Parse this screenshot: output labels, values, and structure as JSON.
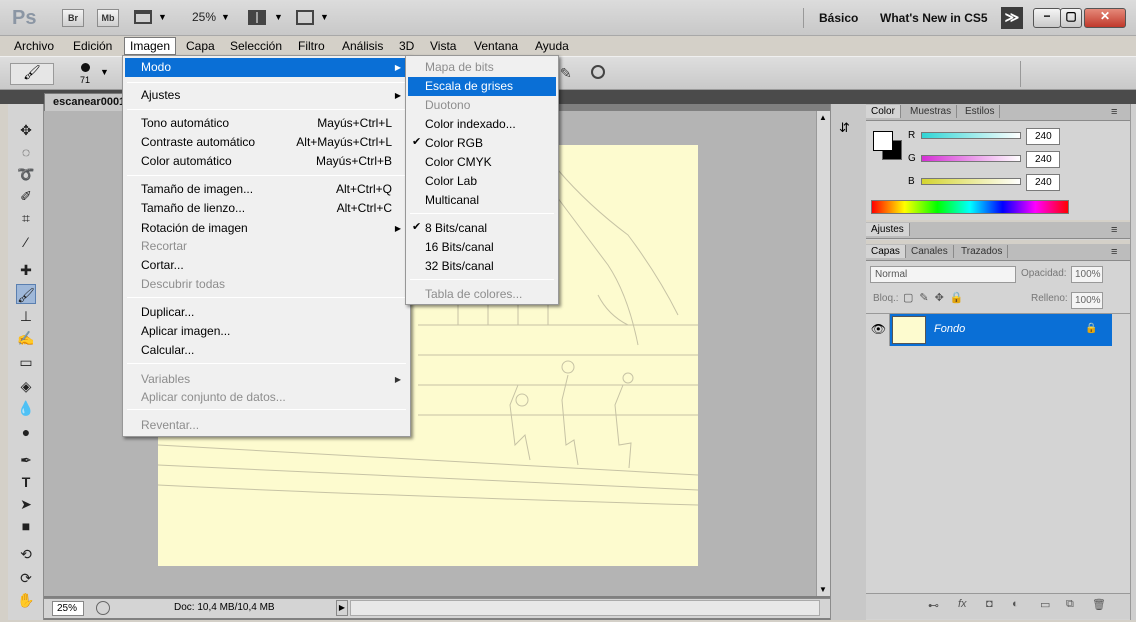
{
  "app": {
    "logo": "Ps",
    "title_buttons": [
      "Br",
      "Mb"
    ],
    "zoom": "25%",
    "workspace_presets": [
      "Básico",
      "What's New in CS5"
    ],
    "more_label": "≫"
  },
  "menubar": [
    "Archivo",
    "Edición",
    "Imagen",
    "Capa",
    "Selección",
    "Filtro",
    "Análisis",
    "3D",
    "Vista",
    "Ventana",
    "Ayuda"
  ],
  "options": {
    "brush_size": "71"
  },
  "document": {
    "tab": "escanear0001"
  },
  "imagen_menu": {
    "items": [
      {
        "label": "Modo",
        "shortcut": "",
        "submenu": true,
        "disabled": false,
        "highlight": true
      },
      {
        "label": "Ajustes",
        "shortcut": "",
        "submenu": true,
        "disabled": false
      },
      {
        "label": "Tono automático",
        "shortcut": "Mayús+Ctrl+L",
        "disabled": false
      },
      {
        "label": "Contraste automático",
        "shortcut": "Alt+Mayús+Ctrl+L",
        "disabled": false
      },
      {
        "label": "Color automático",
        "shortcut": "Mayús+Ctrl+B",
        "disabled": false
      },
      {
        "label": "Tamaño de imagen...",
        "shortcut": "Alt+Ctrl+Q",
        "disabled": false
      },
      {
        "label": "Tamaño de lienzo...",
        "shortcut": "Alt+Ctrl+C",
        "disabled": false
      },
      {
        "label": "Rotación de imagen",
        "shortcut": "",
        "submenu": true,
        "disabled": false
      },
      {
        "label": "Recortar",
        "shortcut": "",
        "disabled": true
      },
      {
        "label": "Cortar...",
        "shortcut": "",
        "disabled": false
      },
      {
        "label": "Descubrir todas",
        "shortcut": "",
        "disabled": true
      },
      {
        "label": "Duplicar...",
        "shortcut": "",
        "disabled": false
      },
      {
        "label": "Aplicar imagen...",
        "shortcut": "",
        "disabled": false
      },
      {
        "label": "Calcular...",
        "shortcut": "",
        "disabled": false
      },
      {
        "label": "Variables",
        "shortcut": "",
        "submenu": true,
        "disabled": true
      },
      {
        "label": "Aplicar conjunto de datos...",
        "shortcut": "",
        "disabled": true
      },
      {
        "label": "Reventar...",
        "shortcut": "",
        "disabled": true
      }
    ]
  },
  "modo_menu": {
    "items": [
      {
        "label": "Mapa de bits",
        "disabled": true
      },
      {
        "label": "Escala de grises",
        "disabled": false,
        "highlight": true
      },
      {
        "label": "Duotono",
        "disabled": true
      },
      {
        "label": "Color indexado...",
        "disabled": false
      },
      {
        "label": "Color RGB",
        "disabled": false,
        "checked": true
      },
      {
        "label": "Color CMYK",
        "disabled": false
      },
      {
        "label": "Color Lab",
        "disabled": false
      },
      {
        "label": "Multicanal",
        "disabled": false
      },
      {
        "label": "8 Bits/canal",
        "disabled": false,
        "checked": true
      },
      {
        "label": "16 Bits/canal",
        "disabled": false
      },
      {
        "label": "32 Bits/canal",
        "disabled": false
      },
      {
        "label": "Tabla de colores...",
        "disabled": true
      }
    ]
  },
  "color_panel": {
    "tabs": [
      "Color",
      "Muestras",
      "Estilos"
    ],
    "channels": [
      {
        "name": "R",
        "value": "240",
        "color": "#2fd4d4"
      },
      {
        "name": "G",
        "value": "240",
        "color": "#d42fd4"
      },
      {
        "name": "B",
        "value": "240",
        "color": "#d4d42f"
      }
    ]
  },
  "adjust_panel": {
    "title": "Ajustes"
  },
  "layers_panel": {
    "tabs": [
      "Capas",
      "Canales",
      "Trazados"
    ],
    "blend_mode": "Normal",
    "opacity_label": "Opacidad:",
    "opacity": "100%",
    "lock_label": "Bloq.:",
    "fill_label": "Relleno:",
    "fill": "100%",
    "layers": [
      {
        "name": "Fondo"
      }
    ]
  },
  "status": {
    "zoom": "25%",
    "doc": "Doc: 10,4 MB/10,4 MB"
  },
  "colors": {
    "accent": "#0a6fd6",
    "paper": "#fdfbcf"
  }
}
